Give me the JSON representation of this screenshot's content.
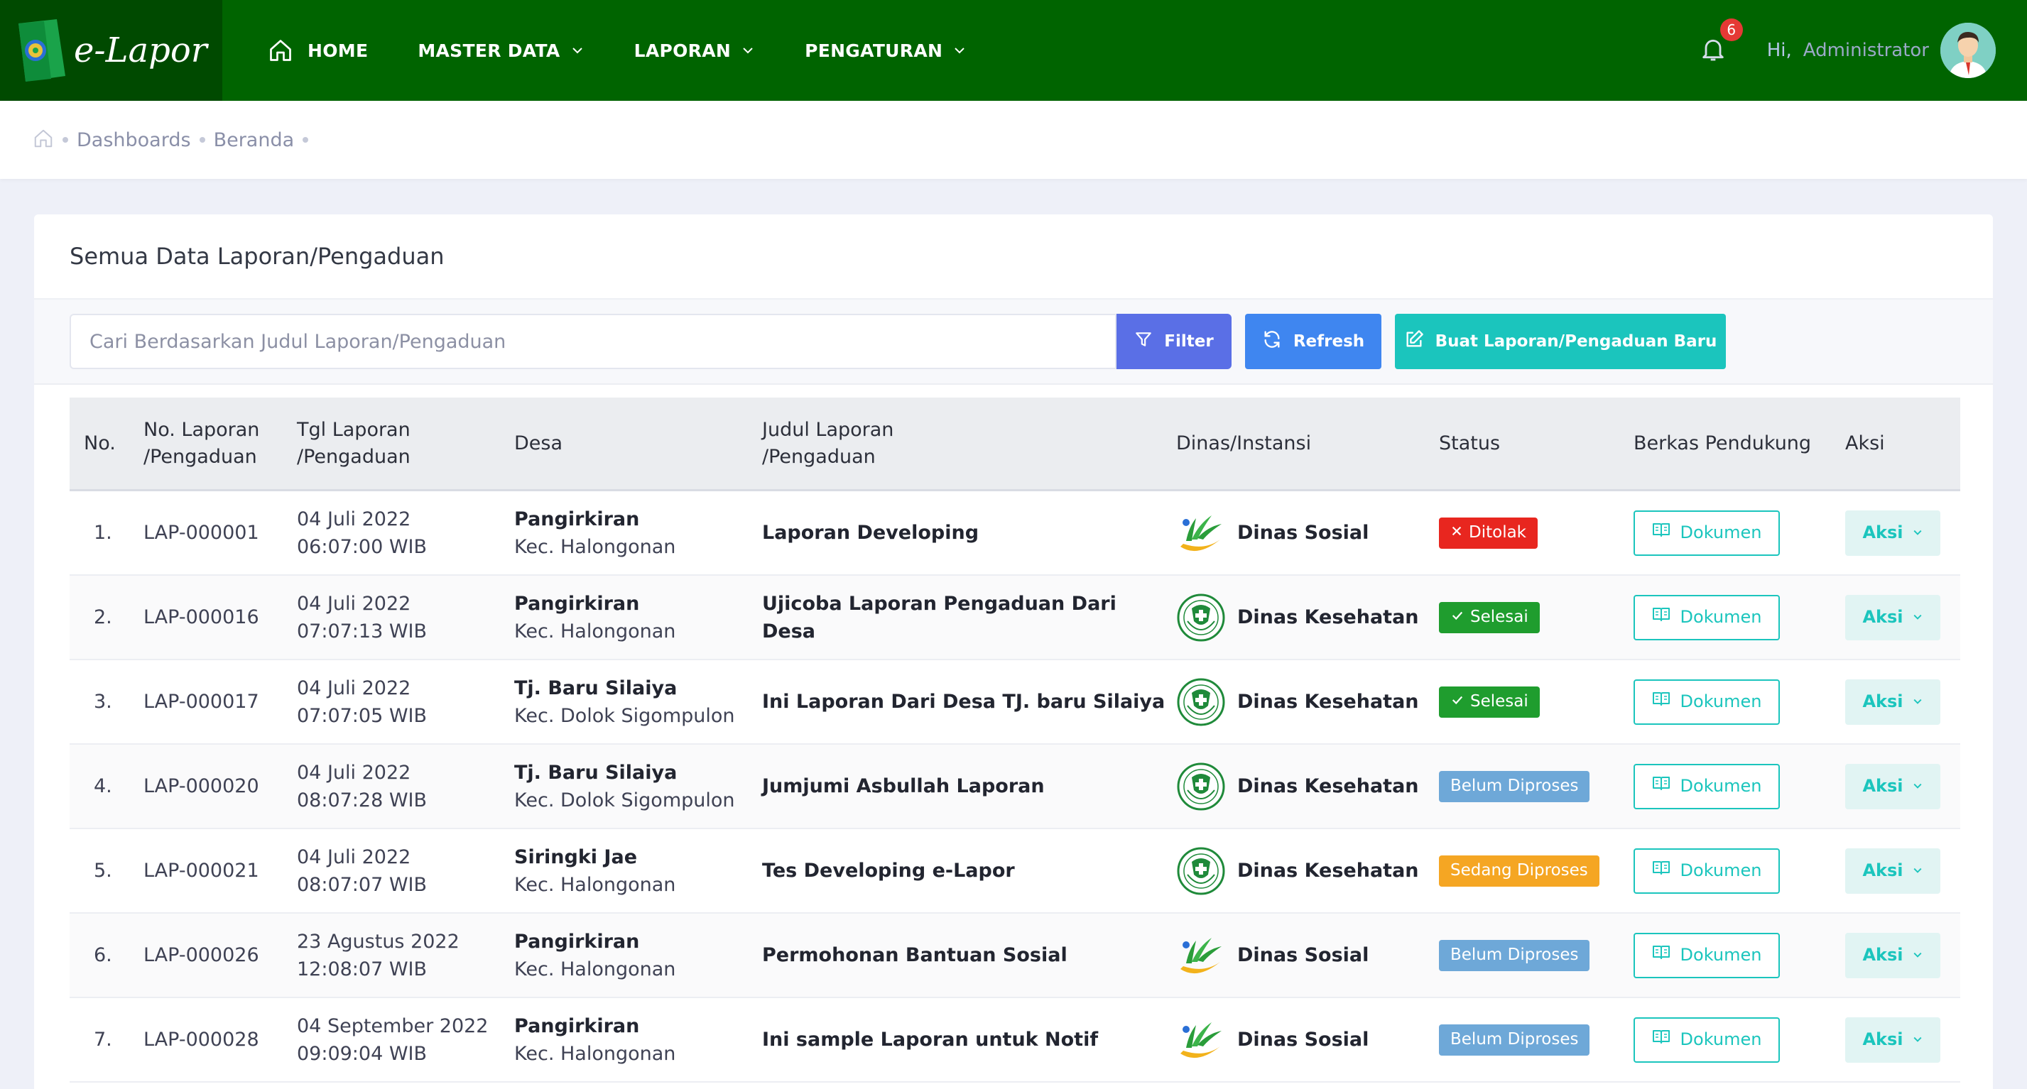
{
  "brand": {
    "name": "e-Lapor"
  },
  "nav": {
    "home": "HOME",
    "master_data": "MASTER DATA",
    "laporan": "LAPORAN",
    "pengaturan": "PENGATURAN"
  },
  "user": {
    "greeting": "Hi,",
    "name": "Administrator",
    "notifications": "6"
  },
  "breadcrumb": {
    "items": [
      "Dashboards",
      "Beranda"
    ]
  },
  "card": {
    "title": "Semua Data Laporan/Pengaduan",
    "search_placeholder": "Cari Berdasarkan Judul Laporan/Pengaduan",
    "filter_label": "Filter",
    "refresh_label": "Refresh",
    "new_label": "Buat Laporan/Pengaduan Baru"
  },
  "table": {
    "headers": {
      "no": "No.",
      "no_laporan_1": "No. Laporan",
      "no_laporan_2": "/Pengaduan",
      "tgl_1": "Tgl Laporan",
      "tgl_2": "/Pengaduan",
      "desa": "Desa",
      "judul_1": "Judul Laporan",
      "judul_2": "/Pengaduan",
      "dinas": "Dinas/Instansi",
      "status": "Status",
      "berkas": "Berkas Pendukung",
      "aksi": "Aksi"
    },
    "dokumen_label": "Dokumen",
    "aksi_label": "Aksi",
    "rows": [
      {
        "no": "1.",
        "nolap": "LAP-000001",
        "tgl": "04 Juli 2022",
        "jam": "06:07:00 WIB",
        "desa": "Pangirkiran",
        "kec": "Kec. Halongonan",
        "judul": "Laporan Developing",
        "dinas": "Dinas Sosial",
        "dinas_type": "sosial",
        "status": "Ditolak",
        "status_type": "ditolak"
      },
      {
        "no": "2.",
        "nolap": "LAP-000016",
        "tgl": "04 Juli 2022",
        "jam": "07:07:13 WIB",
        "desa": "Pangirkiran",
        "kec": "Kec. Halongonan",
        "judul": "Ujicoba Laporan Pengaduan Dari Desa",
        "dinas": "Dinas Kesehatan",
        "dinas_type": "kesehatan",
        "status": "Selesai",
        "status_type": "selesai"
      },
      {
        "no": "3.",
        "nolap": "LAP-000017",
        "tgl": "04 Juli 2022",
        "jam": "07:07:05 WIB",
        "desa": "Tj. Baru Silaiya",
        "kec": "Kec. Dolok Sigompulon",
        "judul": "Ini Laporan Dari Desa TJ. baru Silaiya",
        "dinas": "Dinas Kesehatan",
        "dinas_type": "kesehatan",
        "status": "Selesai",
        "status_type": "selesai"
      },
      {
        "no": "4.",
        "nolap": "LAP-000020",
        "tgl": "04 Juli 2022",
        "jam": "08:07:28 WIB",
        "desa": "Tj. Baru Silaiya",
        "kec": "Kec. Dolok Sigompulon",
        "judul": "Jumjumi Asbullah Laporan",
        "dinas": "Dinas Kesehatan",
        "dinas_type": "kesehatan",
        "status": "Belum Diproses",
        "status_type": "belum"
      },
      {
        "no": "5.",
        "nolap": "LAP-000021",
        "tgl": "04 Juli 2022",
        "jam": "08:07:07 WIB",
        "desa": "Siringki Jae",
        "kec": "Kec. Halongonan",
        "judul": "Tes Developing e-Lapor",
        "dinas": "Dinas Kesehatan",
        "dinas_type": "kesehatan",
        "status": "Sedang Diproses",
        "status_type": "sedang"
      },
      {
        "no": "6.",
        "nolap": "LAP-000026",
        "tgl": "23 Agustus 2022",
        "jam": "12:08:07 WIB",
        "desa": "Pangirkiran",
        "kec": "Kec. Halongonan",
        "judul": "Permohonan Bantuan Sosial",
        "dinas": "Dinas Sosial",
        "dinas_type": "sosial",
        "status": "Belum Diproses",
        "status_type": "belum"
      },
      {
        "no": "7.",
        "nolap": "LAP-000028",
        "tgl": "04 September 2022",
        "jam": "09:09:04 WIB",
        "desa": "Pangirkiran",
        "kec": "Kec. Halongonan",
        "judul": "Ini sample Laporan untuk Notif",
        "dinas": "Dinas Sosial",
        "dinas_type": "sosial",
        "status": "Belum Diproses",
        "status_type": "belum"
      }
    ]
  }
}
